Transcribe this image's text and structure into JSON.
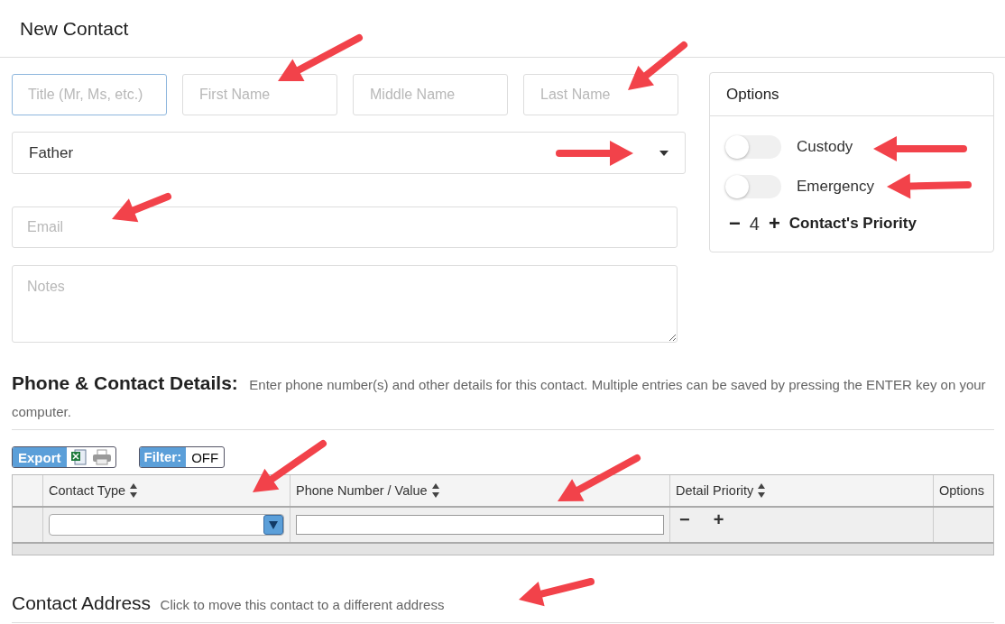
{
  "page_title": "New Contact",
  "name_fields": [
    {
      "placeholder": "Title (Mr, Ms, etc.)",
      "focused": true
    },
    {
      "placeholder": "First Name",
      "focused": false
    },
    {
      "placeholder": "Middle Name",
      "focused": false
    },
    {
      "placeholder": "Last Name",
      "focused": false
    }
  ],
  "relationship_select": {
    "value": "Father"
  },
  "email": {
    "placeholder": "Email"
  },
  "notes": {
    "placeholder": "Notes"
  },
  "options": {
    "title": "Options",
    "toggles": [
      {
        "label": "Custody",
        "on": false
      },
      {
        "label": "Emergency",
        "on": false
      }
    ],
    "priority": {
      "minus": "−",
      "value": "4",
      "plus": "+",
      "label": "Contact's Priority"
    }
  },
  "details": {
    "title": "Phone & Contact Details:",
    "description": "Enter phone number(s) and other details for this contact. Multiple entries can be saved by pressing the ENTER key on your computer.",
    "export_label": "Export",
    "filter_label": "Filter:",
    "filter_value": "OFF",
    "columns": [
      {
        "sortable": false
      },
      {
        "label": "Contact Type",
        "sortable": true
      },
      {
        "label": "Phone Number / Value",
        "sortable": true
      },
      {
        "label": "Detail Priority",
        "sortable": true
      },
      {
        "label": "Options",
        "sortable": false
      }
    ],
    "row": {
      "priority_minus": "−",
      "priority_plus": "+"
    }
  },
  "address": {
    "title": "Contact Address",
    "description": "Click to move this contact to a different address"
  }
}
